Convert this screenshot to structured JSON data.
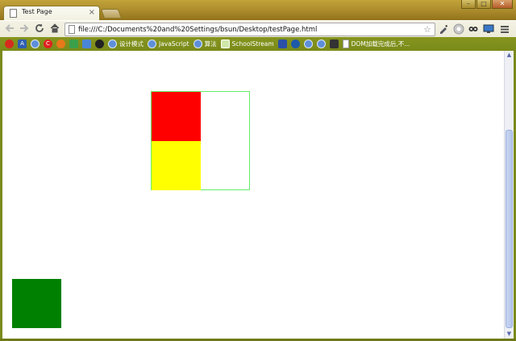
{
  "tab": {
    "title": "Test Page",
    "close_glyph": "×"
  },
  "window_controls": {
    "minimize": "–",
    "maximize": "□",
    "close": "✕"
  },
  "toolbar": {
    "address": "file:///C:/Documents%20and%20Settings/bsun/Desktop/testPage.html"
  },
  "bookmarks": [
    {
      "icon": "weibo-icon",
      "label": ""
    },
    {
      "icon": "a-icon",
      "label": ""
    },
    {
      "icon": "globe-icon",
      "label": ""
    },
    {
      "icon": "c-icon",
      "label": ""
    },
    {
      "icon": "firefox-icon",
      "label": ""
    },
    {
      "icon": "puzzle-icon",
      "label": ""
    },
    {
      "icon": "chat-icon",
      "label": ""
    },
    {
      "icon": "penguin-icon",
      "label": ""
    },
    {
      "icon": "globe-icon",
      "label": "设计模式"
    },
    {
      "icon": "globe-icon",
      "label": "JavaScript"
    },
    {
      "icon": "globe-icon",
      "label": "算法"
    },
    {
      "icon": "school-icon",
      "label": "SchoolStream"
    },
    {
      "icon": "paw-icon",
      "label": ""
    },
    {
      "icon": "refresh-icon",
      "label": ""
    },
    {
      "icon": "globe-icon",
      "label": ""
    },
    {
      "icon": "globe-icon",
      "label": ""
    },
    {
      "icon": "runner-icon",
      "label": ""
    },
    {
      "icon": "page-icon",
      "label": "DOM加载完成后,不..."
    }
  ],
  "page": {
    "squares": {
      "red": "#ff0000",
      "yellow": "#ffff00",
      "green": "#008000"
    },
    "outer_border_color": "#66ee66"
  }
}
